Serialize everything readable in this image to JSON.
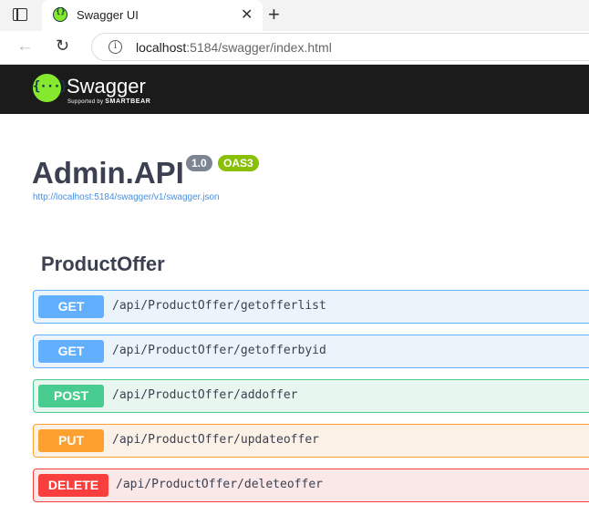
{
  "browser": {
    "tab_title": "Swagger UI",
    "url_host": "localhost",
    "url_rest": ":5184/swagger/index.html"
  },
  "swagger": {
    "logo_word": "Swagger",
    "logo_supported": "Supported by",
    "logo_brand": "SMARTBEAR",
    "logo_mark": "{···}"
  },
  "info": {
    "title": "Admin.API",
    "version": "1.0",
    "oas": "OAS3",
    "spec_url": "http://localhost:5184/swagger/v1/swagger.json"
  },
  "tag": {
    "name": "ProductOffer"
  },
  "operations": [
    {
      "method": "GET",
      "path": "/api/ProductOffer/getofferlist"
    },
    {
      "method": "GET",
      "path": "/api/ProductOffer/getofferbyid"
    },
    {
      "method": "POST",
      "path": "/api/ProductOffer/addoffer"
    },
    {
      "method": "PUT",
      "path": "/api/ProductOffer/updateoffer"
    },
    {
      "method": "DELETE",
      "path": "/api/ProductOffer/deleteoffer"
    }
  ],
  "colors": {
    "get": "#61affe",
    "post": "#49cc90",
    "put": "#fca130",
    "delete": "#f93e3e",
    "swagger_green": "#85ea2d"
  }
}
